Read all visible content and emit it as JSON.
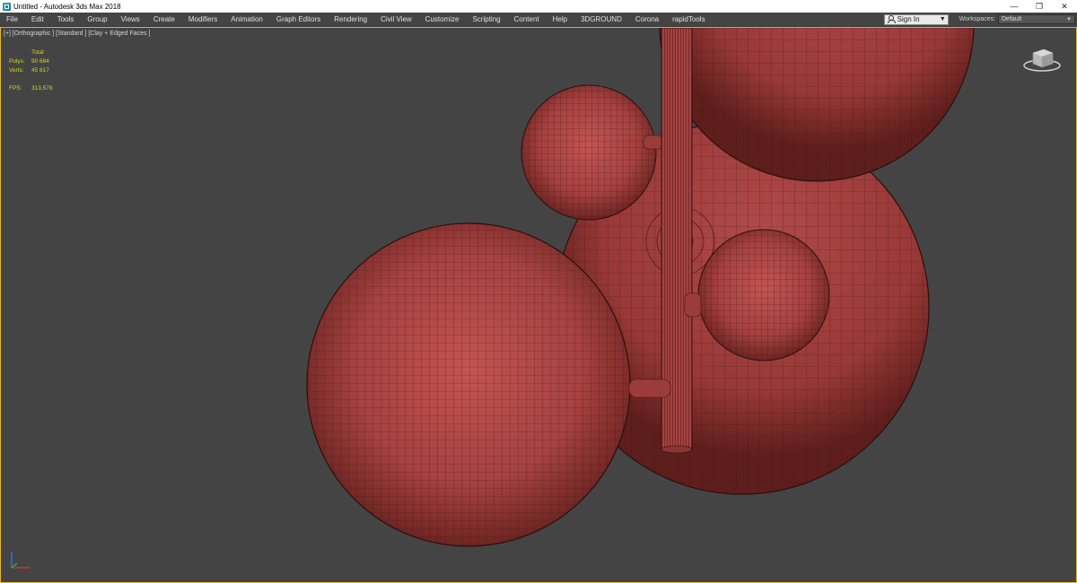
{
  "window": {
    "title": "Untitled - Autodesk 3ds Max 2018",
    "minimize_glyph": "—",
    "restore_glyph": "❐",
    "close_glyph": "✕"
  },
  "menu": {
    "items": [
      "File",
      "Edit",
      "Tools",
      "Group",
      "Views",
      "Create",
      "Modifiers",
      "Animation",
      "Graph Editors",
      "Rendering",
      "Civil View",
      "Customize",
      "Scripting",
      "Content",
      "Help",
      "3DGROUND",
      "Corona",
      "rapidTools"
    ],
    "sign_in": "Sign In",
    "workspaces_label": "Workspaces:",
    "workspace_value": "Default"
  },
  "viewport": {
    "label": "[+] [Orthographic ] [Standard ] [Clay + Edged Faces ]",
    "stats": {
      "total_label": "Total",
      "polys_label": "Polys:",
      "polys_value": "90 684",
      "verts_label": "Verts:",
      "verts_value": "45 817",
      "fps_label": "FPS:",
      "fps_value": "313,578"
    }
  },
  "colors": {
    "clay": "#a8413e",
    "wire": "#3a1514",
    "viewport_bg": "#444444",
    "active_border": "#e2b92a",
    "stats_text": "#d6d326"
  },
  "icons": {
    "app": "3ds-max-logo-icon",
    "user": "user-icon",
    "viewcube": "viewcube-icon",
    "axis": "axis-tripod-icon"
  }
}
